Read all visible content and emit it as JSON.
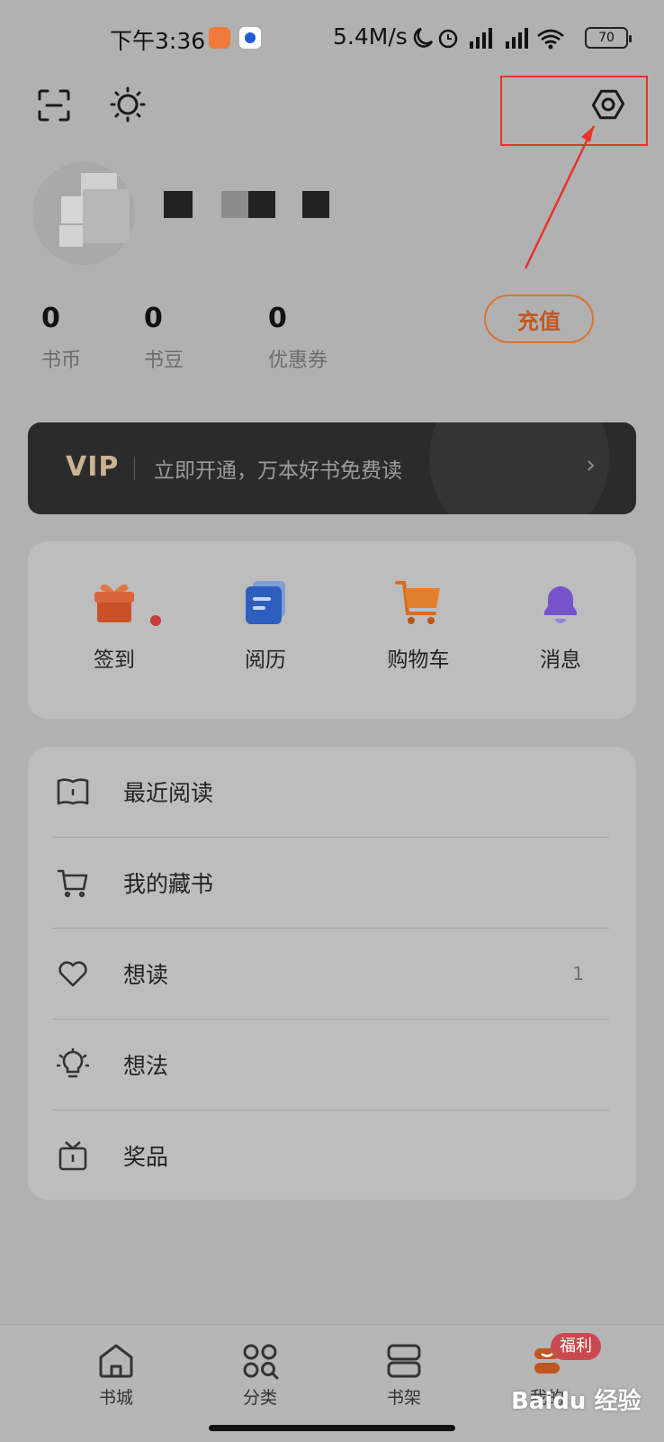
{
  "status_bar": {
    "time": "下午3:36",
    "net_speed": "5.4M/s",
    "signal_icons": "☾ ⏰ HD▂▄▆ HD▂▄▆ ",
    "battery": "70"
  },
  "profile": {
    "stats": [
      {
        "value": "0",
        "label": "书币"
      },
      {
        "value": "0",
        "label": "书豆"
      },
      {
        "value": "0",
        "label": "优惠券"
      }
    ],
    "recharge_label": "充值"
  },
  "vip": {
    "logo": "VIP",
    "text": "立即开通，万本好书免费读",
    "arrow": "›"
  },
  "quick_actions": [
    {
      "label": "签到",
      "icon": "gift-icon",
      "color": "#d25a2e"
    },
    {
      "label": "阅历",
      "icon": "document-icon",
      "color": "#2e63c8"
    },
    {
      "label": "购物车",
      "icon": "cart-icon",
      "color": "#e37a2a"
    },
    {
      "label": "消息",
      "icon": "bell-icon",
      "color": "#7a56d6"
    }
  ],
  "menu": [
    {
      "label": "最近阅读",
      "icon": "book-open-icon",
      "count": ""
    },
    {
      "label": "我的藏书",
      "icon": "cart-outline-icon",
      "count": ""
    },
    {
      "label": "想读",
      "icon": "heart-icon",
      "count": "1"
    },
    {
      "label": "想法",
      "icon": "lightbulb-icon",
      "count": ""
    },
    {
      "label": "奖品",
      "icon": "prize-icon",
      "count": ""
    }
  ],
  "bottom_nav": [
    {
      "label": "书城",
      "icon": "home-icon"
    },
    {
      "label": "分类",
      "icon": "category-icon"
    },
    {
      "label": "书架",
      "icon": "bookshelf-icon"
    },
    {
      "label": "我的",
      "icon": "profile-icon"
    }
  ],
  "badge": "福利",
  "watermark": "Baidu 经验",
  "colors": {
    "accent": "#d9742f",
    "highlight_box": "#e8332b"
  }
}
